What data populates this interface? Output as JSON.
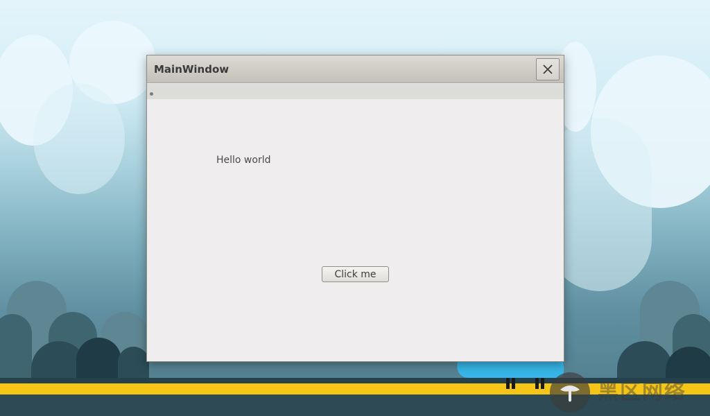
{
  "window": {
    "title": "MainWindow",
    "close_icon": "close-icon"
  },
  "content": {
    "label_text": "Hello world",
    "button_label": "Click me"
  },
  "desktop": {
    "watermark_logo": "mushroom-logo",
    "watermark_text": "黑区网络"
  },
  "colors": {
    "road_stripe": "#f5c518",
    "mascot": "#38b6e8",
    "window_bg": "#efedee"
  }
}
